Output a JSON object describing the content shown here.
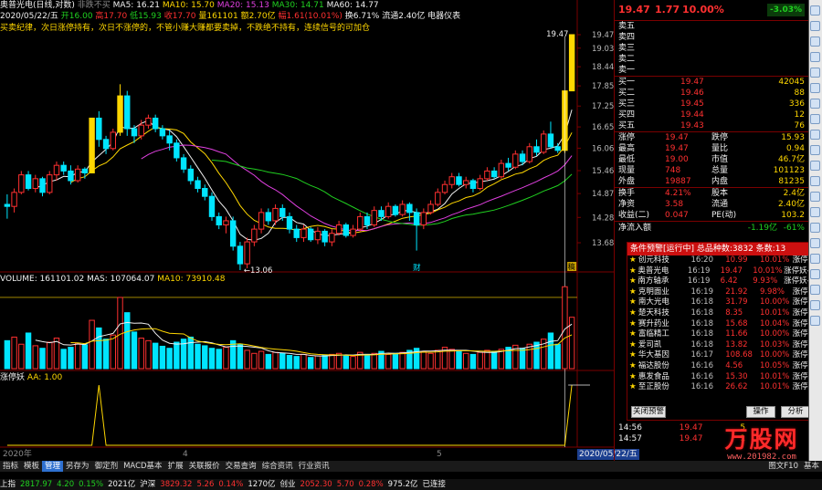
{
  "header": {
    "stock_title": "奥普光电(日线,对数)",
    "pattern": "非跌不买",
    "ma5_label": "MA5: 16.21",
    "ma10_label": "MA10: 15.70",
    "ma20_label": "MA20: 15.13",
    "ma30_label": "MA30: 14.71",
    "ma60_label": "MA60: 14.77",
    "date": "2020/05/22/五",
    "open": "开16.00",
    "high": "高17.70",
    "low": "低15.93",
    "close": "收17.70",
    "volume": "量161101",
    "amount": "额2.70亿",
    "change": "幅1.61(10.01%)",
    "turnover": "换6.71%",
    "float": "流通2.40亿",
    "sector": "电器仪表",
    "strategy_text": "买卖纪律，次日涨停持有，次日不涨停的，不管小赚大赚都要卖掉，不跌绝不持有，连续信号的可加仓"
  },
  "price_axis": [
    "19.47",
    "19.03",
    "18.44",
    "17.85",
    "17.25",
    "16.65",
    "16.06",
    "15.46",
    "14.87",
    "14.28",
    "13.68"
  ],
  "price_annotations": {
    "top": "19.47",
    "low": "13.06",
    "event": "财",
    "tag": "稿"
  },
  "volume_header": {
    "title": "VOLUME: 161101.02",
    "mas": "MAS: 107064.07",
    "ma10": "MA10: 73910.48"
  },
  "indicator_header": {
    "title": "涨停妖",
    "aa": "AA: 1.00"
  },
  "time_axis": {
    "year": "2020年",
    "m4": "4",
    "m5": "5",
    "current": "2020/05/22/五"
  },
  "quote": {
    "price": "19.47",
    "change": "1.77",
    "pct": "10.00%",
    "badge": "-3.03%",
    "sell": [
      {
        "label": "卖五",
        "price": "",
        "vol": ""
      },
      {
        "label": "卖四",
        "price": "",
        "vol": ""
      },
      {
        "label": "卖三",
        "price": "",
        "vol": ""
      },
      {
        "label": "卖二",
        "price": "",
        "vol": ""
      },
      {
        "label": "卖一",
        "price": "",
        "vol": ""
      }
    ],
    "buy": [
      {
        "label": "买一",
        "price": "19.47",
        "vol": "42045"
      },
      {
        "label": "买二",
        "price": "19.46",
        "vol": "88"
      },
      {
        "label": "买三",
        "price": "19.45",
        "vol": "336"
      },
      {
        "label": "买四",
        "price": "19.44",
        "vol": "12"
      },
      {
        "label": "买五",
        "price": "19.43",
        "vol": "76"
      }
    ],
    "stats": [
      {
        "l1": "涨停",
        "v1": "19.47",
        "l2": "跌停",
        "v2": "15.93"
      },
      {
        "l1": "最高",
        "v1": "19.47",
        "l2": "量比",
        "v2": "0.94"
      },
      {
        "l1": "最低",
        "v1": "19.00",
        "l2": "市值",
        "v2": "46.7亿"
      },
      {
        "l1": "现量",
        "v1": "748",
        "l2": "总量",
        "v2": "101123"
      },
      {
        "l1": "外盘",
        "v1": "19887",
        "l2": "内盘",
        "v2": "81235"
      }
    ],
    "stats2": [
      {
        "l1": "换手",
        "v1": "4.21%",
        "l2": "股本",
        "v2": "2.4亿"
      },
      {
        "l1": "净资",
        "v1": "3.58",
        "l2": "流通",
        "v2": "2.40亿"
      },
      {
        "l1": "收益(二)",
        "v1": "0.047",
        "l2": "PE(动)",
        "v2": "103.2"
      }
    ],
    "netflow_label": "净流入额",
    "netflow_value": "-1.19亿",
    "netflow_pct": "-61%"
  },
  "alerts": {
    "title": "条件预警[运行中] 总品种数:3832 条数:13",
    "items": [
      {
        "name": "创元科技",
        "time": "16:20",
        "price": "10.99",
        "pct": "10.01%",
        "type": "涨停妖"
      },
      {
        "name": "奥普光电",
        "time": "16:19",
        "price": "19.47",
        "pct": "10.01%",
        "type": "涨停妖-首"
      },
      {
        "name": "南方轴承",
        "time": "16:19",
        "price": "6.42",
        "pct": "9.93%",
        "type": "涨停妖-首"
      },
      {
        "name": "克明面业",
        "time": "16:19",
        "price": "21.92",
        "pct": "9.98%",
        "type": "涨停妖"
      },
      {
        "name": "南大光电",
        "time": "16:18",
        "price": "31.79",
        "pct": "10.00%",
        "type": "涨停妖"
      },
      {
        "name": "楚天科技",
        "time": "16:18",
        "price": "8.35",
        "pct": "10.01%",
        "type": "涨停妖"
      },
      {
        "name": "赛升药业",
        "time": "16:18",
        "price": "15.68",
        "pct": "10.04%",
        "type": "涨停妖"
      },
      {
        "name": "富临精工",
        "time": "16:18",
        "price": "11.66",
        "pct": "10.00%",
        "type": "涨停妖"
      },
      {
        "name": "爱司凯",
        "time": "16:18",
        "price": "13.82",
        "pct": "10.03%",
        "type": "涨停妖"
      },
      {
        "name": "华大基因",
        "time": "16:17",
        "price": "108.68",
        "pct": "10.00%",
        "type": "涨停妖"
      },
      {
        "name": "福达股份",
        "time": "16:16",
        "price": "4.56",
        "pct": "10.05%",
        "type": "涨停妖"
      },
      {
        "name": "惠发食品",
        "time": "16:16",
        "price": "15.30",
        "pct": "10.01%",
        "type": "涨停妖"
      },
      {
        "name": "至正股份",
        "time": "16:16",
        "price": "26.62",
        "pct": "10.01%",
        "type": "涨停妖"
      }
    ],
    "close_btn": "关闭预警",
    "op_btn": "操作",
    "analyze_btn": "分析"
  },
  "tick_rows": [
    {
      "t": "14:56",
      "p": "19.47",
      "v": "5"
    },
    {
      "t": "14:57",
      "p": "19.47",
      "v": "1"
    }
  ],
  "tabs": [
    "指标",
    "模板",
    "管理",
    "另存为",
    "御定剂",
    "MACD基本",
    "扩展",
    "关联报价",
    "交易查询",
    "综合资讯",
    "行业资讯"
  ],
  "tabs_right": {
    "label": "图文F10",
    "alt": "基本"
  },
  "status": [
    {
      "text": "上指",
      "cls": "white"
    },
    {
      "text": "2817.97",
      "cls": "green"
    },
    {
      "text": "4.20",
      "cls": "green"
    },
    {
      "text": "0.15%",
      "cls": "green"
    },
    {
      "text": "2021亿",
      "cls": "white"
    },
    {
      "text": "沪深",
      "cls": "white"
    },
    {
      "text": "3829.32",
      "cls": "red"
    },
    {
      "text": "5.26",
      "cls": "red"
    },
    {
      "text": "0.14%",
      "cls": "red"
    },
    {
      "text": "1270亿",
      "cls": "white"
    },
    {
      "text": "创业",
      "cls": "white"
    },
    {
      "text": "2052.30",
      "cls": "red"
    },
    {
      "text": "5.70",
      "cls": "red"
    },
    {
      "text": "0.28%",
      "cls": "red"
    },
    {
      "text": "975.2亿",
      "cls": "white"
    },
    {
      "text": "已连接",
      "cls": "white"
    }
  ],
  "watermark": {
    "brand": "万股网",
    "url": "www.201982.com"
  },
  "colors": {
    "up": "#ff3030",
    "down": "#00e5ff",
    "limit": "#ffd700",
    "ma5": "#f0f0f0",
    "ma10": "#ffd700",
    "ma20": "#e040e0",
    "ma30": "#20d020"
  },
  "chart_data": {
    "type": "candlestick",
    "candles": [
      [
        14.6,
        14.55,
        14.85,
        14.25
      ],
      [
        14.55,
        14.9,
        15.0,
        14.4
      ],
      [
        14.9,
        15.35,
        15.45,
        14.85
      ],
      [
        15.35,
        15.0,
        15.45,
        14.95
      ],
      [
        15.0,
        15.25,
        15.35,
        14.9
      ],
      [
        15.25,
        14.9,
        15.3,
        14.8
      ],
      [
        14.9,
        15.35,
        15.45,
        14.85
      ],
      [
        15.35,
        15.6,
        15.7,
        15.2
      ],
      [
        15.6,
        15.45,
        15.7,
        15.35
      ],
      [
        15.45,
        15.2,
        15.6,
        15.1
      ],
      [
        15.2,
        15.5,
        15.6,
        15.15
      ],
      [
        15.5,
        15.4,
        15.55,
        15.25
      ],
      [
        15.4,
        16.9,
        16.9,
        15.4
      ],
      [
        16.9,
        16.3,
        17.1,
        16.1
      ],
      [
        16.3,
        16.05,
        16.4,
        15.9
      ],
      [
        16.05,
        16.5,
        16.6,
        16.0
      ],
      [
        16.5,
        17.55,
        17.9,
        16.4
      ],
      [
        17.55,
        16.6,
        17.7,
        16.4
      ],
      [
        16.6,
        16.4,
        16.7,
        16.2
      ],
      [
        16.4,
        16.7,
        16.85,
        16.3
      ],
      [
        16.7,
        16.9,
        17.0,
        16.6
      ],
      [
        16.9,
        16.6,
        17.0,
        16.5
      ],
      [
        16.6,
        16.4,
        16.7,
        16.3
      ],
      [
        16.4,
        16.2,
        16.55,
        16.0
      ],
      [
        16.2,
        15.8,
        16.3,
        15.7
      ],
      [
        15.8,
        15.5,
        15.9,
        15.4
      ],
      [
        15.5,
        15.2,
        15.6,
        15.1
      ],
      [
        15.2,
        15.0,
        15.3,
        14.9
      ],
      [
        15.0,
        14.8,
        15.1,
        14.7
      ],
      [
        14.8,
        14.3,
        14.9,
        14.2
      ],
      [
        14.3,
        14.1,
        14.4,
        14.0
      ],
      [
        14.1,
        14.2,
        14.3,
        13.9
      ],
      [
        14.2,
        13.6,
        14.3,
        13.5
      ],
      [
        13.6,
        13.2,
        13.7,
        13.06
      ],
      [
        13.2,
        13.7,
        13.8,
        13.1
      ],
      [
        13.7,
        14.0,
        14.1,
        13.6
      ],
      [
        14.0,
        14.4,
        14.5,
        13.9
      ],
      [
        14.4,
        14.2,
        14.5,
        14.1
      ],
      [
        14.2,
        14.5,
        14.6,
        14.1
      ],
      [
        14.5,
        14.3,
        14.6,
        14.2
      ],
      [
        14.3,
        14.0,
        14.4,
        13.9
      ],
      [
        14.0,
        13.8,
        14.1,
        13.7
      ],
      [
        13.8,
        14.0,
        14.1,
        13.7
      ],
      [
        14.0,
        13.75,
        14.05,
        13.7
      ],
      [
        13.75,
        13.95,
        14.05,
        13.65
      ],
      [
        13.95,
        13.7,
        14.0,
        13.6
      ],
      [
        13.7,
        13.9,
        14.0,
        13.6
      ],
      [
        13.9,
        14.1,
        14.2,
        13.85
      ],
      [
        14.1,
        13.85,
        14.15,
        13.8
      ],
      [
        13.85,
        14.0,
        14.1,
        13.8
      ],
      [
        14.0,
        14.3,
        14.4,
        13.95
      ],
      [
        14.3,
        14.1,
        14.4,
        14.0
      ],
      [
        14.1,
        14.45,
        14.55,
        14.05
      ],
      [
        14.45,
        14.3,
        14.55,
        14.2
      ],
      [
        14.3,
        14.55,
        14.65,
        14.25
      ],
      [
        14.55,
        14.35,
        14.6,
        14.3
      ],
      [
        14.35,
        14.6,
        14.7,
        14.3
      ],
      [
        14.6,
        14.4,
        14.65,
        14.2
      ],
      [
        14.4,
        14.1,
        14.5,
        13.5
      ],
      [
        14.1,
        14.4,
        14.5,
        14.0
      ],
      [
        14.4,
        14.6,
        14.7,
        14.35
      ],
      [
        14.6,
        14.9,
        15.0,
        14.55
      ],
      [
        14.9,
        15.1,
        15.2,
        14.85
      ],
      [
        15.1,
        15.3,
        15.4,
        15.0
      ],
      [
        15.3,
        15.1,
        15.4,
        15.05
      ],
      [
        15.1,
        15.2,
        15.3,
        15.0
      ],
      [
        15.2,
        15.0,
        15.25,
        14.9
      ],
      [
        15.0,
        15.25,
        15.35,
        14.95
      ],
      [
        15.25,
        15.45,
        15.55,
        15.2
      ],
      [
        15.45,
        15.3,
        15.55,
        15.25
      ],
      [
        15.3,
        15.65,
        15.75,
        15.25
      ],
      [
        15.65,
        15.55,
        15.8,
        15.45
      ],
      [
        15.55,
        15.9,
        16.0,
        15.5
      ],
      [
        15.9,
        15.7,
        16.0,
        15.6
      ],
      [
        15.7,
        16.1,
        16.2,
        15.65
      ],
      [
        16.1,
        15.95,
        16.3,
        15.85
      ],
      [
        15.95,
        16.45,
        16.55,
        15.9
      ],
      [
        16.45,
        16.1,
        16.8,
        16.05
      ],
      [
        16.1,
        16.0,
        16.2,
        15.93
      ],
      [
        16.0,
        17.7,
        17.7,
        15.93
      ],
      [
        17.7,
        19.47,
        19.47,
        19.0
      ]
    ],
    "volume": [
      55,
      62,
      48,
      70,
      45,
      40,
      52,
      60,
      38,
      42,
      50,
      47,
      95,
      80,
      58,
      66,
      140,
      110,
      72,
      60,
      55,
      50,
      44,
      40,
      52,
      58,
      62,
      48,
      45,
      40,
      38,
      42,
      55,
      48,
      36,
      30,
      34,
      28,
      32,
      30,
      26,
      24,
      28,
      22,
      25,
      26,
      28,
      30,
      26,
      24,
      32,
      28,
      30,
      34,
      28,
      30,
      32,
      36,
      40,
      34,
      30,
      36,
      42,
      38,
      34,
      30,
      28,
      32,
      36,
      34,
      38,
      42,
      46,
      40,
      48,
      52,
      58,
      70,
      48,
      161,
      101
    ],
    "limit_up_days": [
      12,
      16,
      79,
      80
    ],
    "ylim": [
      13.06,
      19.47
    ],
    "indicator_signal_days": [
      13,
      80
    ]
  }
}
